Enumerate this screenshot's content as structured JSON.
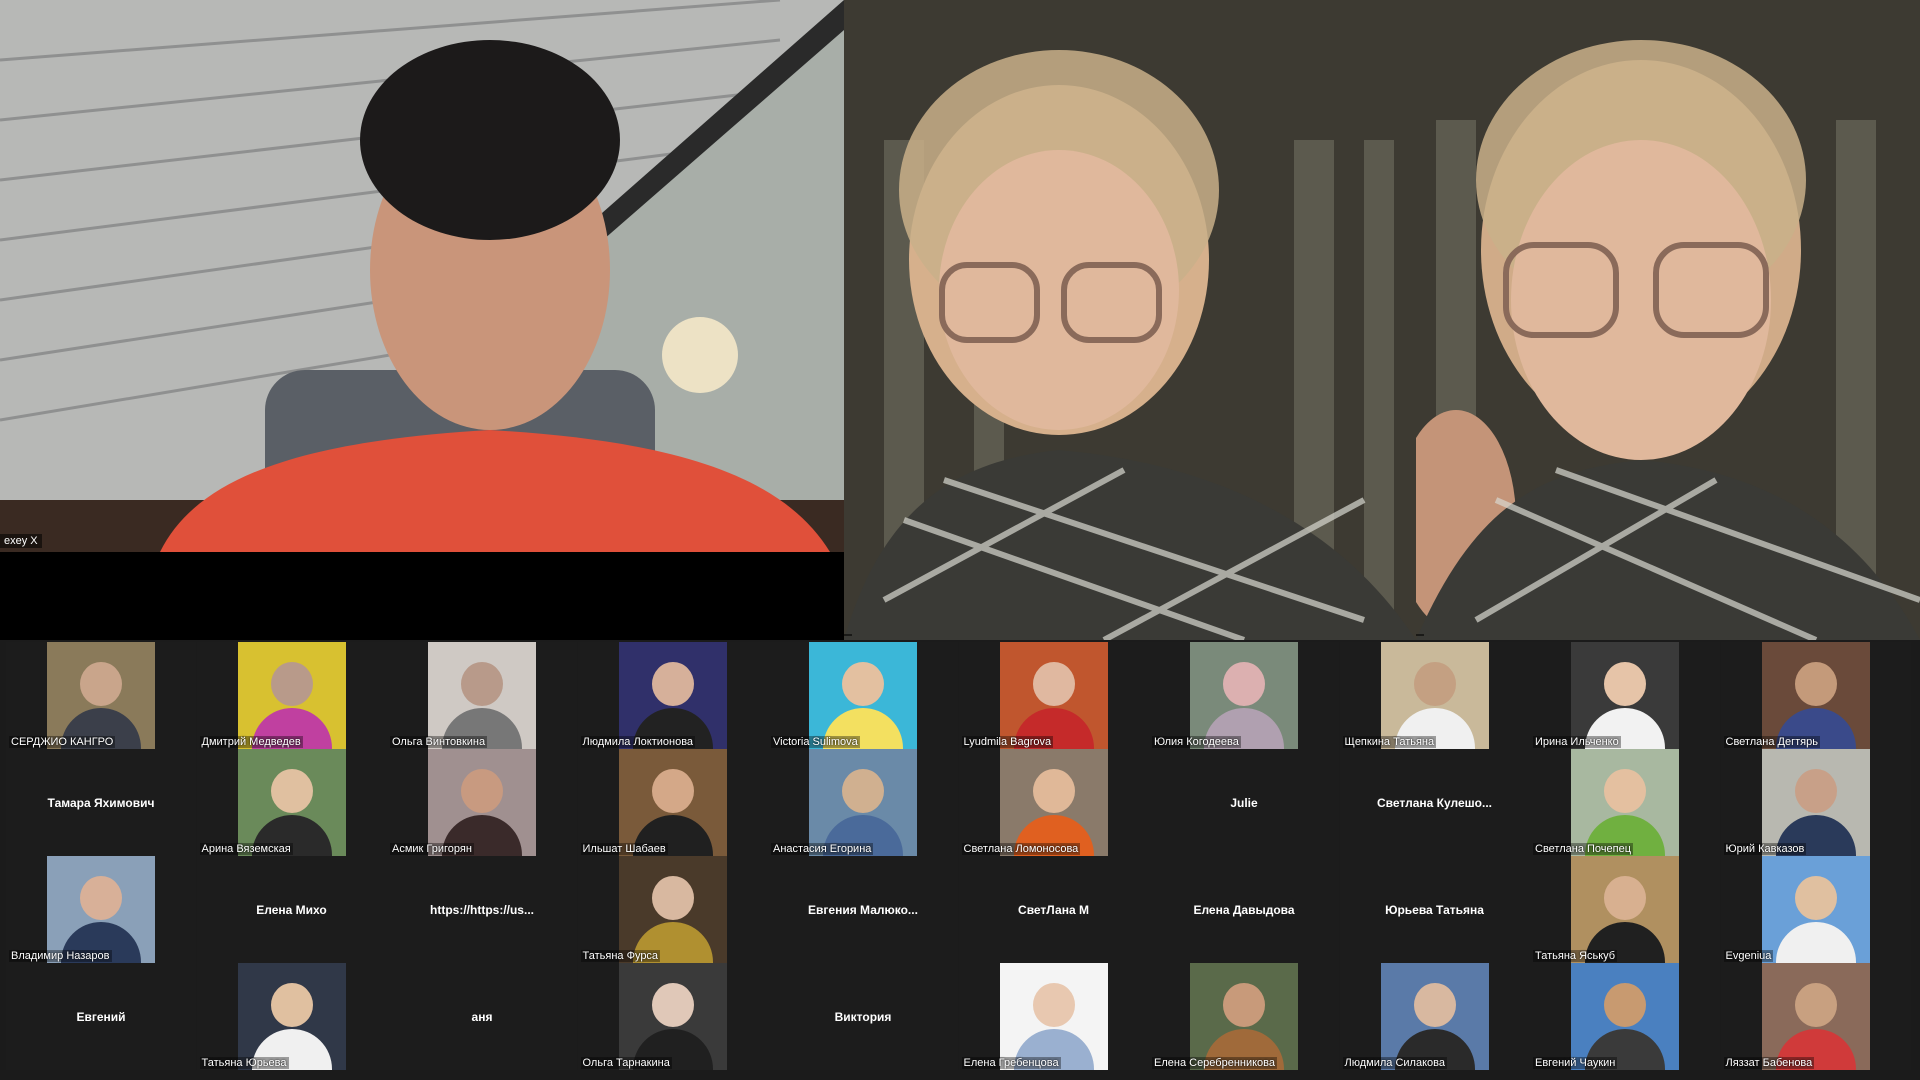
{
  "speakers": [
    {
      "name": "exey X"
    },
    {
      "name": ""
    },
    {
      "name": ""
    }
  ],
  "participants": [
    {
      "name": "СЕРДЖИО КАНГРО",
      "mode": "video",
      "bg": "#8a7a5a",
      "skin": "#c9a58b",
      "shirt": "#3b3f4a"
    },
    {
      "name": "Дмитрий Медведев",
      "mode": "video",
      "bg": "#d8c130",
      "skin": "#b89a8a",
      "shirt": "#c040a0"
    },
    {
      "name": "Ольга Винтовкина",
      "mode": "video",
      "bg": "#cfc9c4",
      "skin": "#b89a8a",
      "shirt": "#777"
    },
    {
      "name": "Людмила Локтионова",
      "mode": "video",
      "bg": "#30306a",
      "skin": "#d6b09a",
      "shirt": "#222"
    },
    {
      "name": "Victoria Sulimova",
      "mode": "video",
      "bg": "#3bb7d8",
      "skin": "#e3c0a0",
      "shirt": "#f3e060"
    },
    {
      "name": "Lyudmila Bagrova",
      "mode": "video",
      "bg": "#c0562e",
      "skin": "#e0b8a0",
      "shirt": "#c52a2a"
    },
    {
      "name": "Юлия Когодеева",
      "mode": "video",
      "bg": "#7a8a7a",
      "skin": "#dcb0b0",
      "shirt": "#b0a0b0"
    },
    {
      "name": "Щепкина Татьяна",
      "mode": "video",
      "bg": "#c9b99a",
      "skin": "#c4a082",
      "shirt": "#f0f0f0"
    },
    {
      "name": "Ирина Ильченко",
      "mode": "video",
      "bg": "#3a3a3a",
      "skin": "#e6c4a8",
      "shirt": "#f2f2f2"
    },
    {
      "name": "Светлана Дегтярь",
      "mode": "video",
      "bg": "#6a4a3a",
      "skin": "#c49a7a",
      "shirt": "#3a4a8a"
    },
    {
      "name": "Тамара Яхимович",
      "mode": "text"
    },
    {
      "name": "Арина Вяземская",
      "mode": "video",
      "bg": "#6a8a5a",
      "skin": "#e0c0a0",
      "shirt": "#2a2a2a"
    },
    {
      "name": "Асмик Григорян",
      "mode": "video",
      "bg": "#a09090",
      "skin": "#c89a80",
      "shirt": "#3a2a2a"
    },
    {
      "name": "Ильшат Шабаев",
      "mode": "video",
      "bg": "#7a5a3a",
      "skin": "#d4a888",
      "shirt": "#202020"
    },
    {
      "name": "Анастасия Егорина",
      "mode": "video",
      "bg": "#6a8aa8",
      "skin": "#d0b090",
      "shirt": "#4a6a9a"
    },
    {
      "name": "Светлана Ломоносова",
      "mode": "video",
      "bg": "#8a7a6a",
      "skin": "#e0b898",
      "shirt": "#e06020"
    },
    {
      "name": "Julie",
      "mode": "text"
    },
    {
      "name": "Светлана  Кулешо...",
      "mode": "text"
    },
    {
      "name": "Светлана Почепец",
      "mode": "video",
      "bg": "#a8b8a0",
      "skin": "#e4c0a0",
      "shirt": "#70b040"
    },
    {
      "name": "Юрий Кавказов",
      "mode": "video",
      "bg": "#b8b8b0",
      "skin": "#c8a088",
      "shirt": "#2a3a5a"
    },
    {
      "name": "Владимир Назаров",
      "mode": "video",
      "bg": "#8aa0b8",
      "skin": "#d8b098",
      "shirt": "#2a3a5a"
    },
    {
      "name": "Елена Михо",
      "mode": "text"
    },
    {
      "name": "https://https://us...",
      "mode": "text"
    },
    {
      "name": "Татьяна Фурса",
      "mode": "video",
      "bg": "#4a3a2a",
      "skin": "#d8b8a0",
      "shirt": "#b09030"
    },
    {
      "name": "Евгения  Малюко...",
      "mode": "text"
    },
    {
      "name": "СветЛана М",
      "mode": "text"
    },
    {
      "name": "Елена Давыдова",
      "mode": "text"
    },
    {
      "name": "Юрьева Татьяна",
      "mode": "text"
    },
    {
      "name": "Татьяна Яськуб",
      "mode": "video",
      "bg": "#b09060",
      "skin": "#d8b090",
      "shirt": "#202020"
    },
    {
      "name": "Evgeniua",
      "mode": "video",
      "bg": "#6aa0d8",
      "skin": "#e0c0a0",
      "shirt": "#f0f0f0"
    },
    {
      "name": "Евгений",
      "mode": "text"
    },
    {
      "name": "Татьяна Юрьева",
      "mode": "video",
      "bg": "#303848",
      "skin": "#e0c0a0",
      "shirt": "#f0f0f0"
    },
    {
      "name": "аня",
      "mode": "text"
    },
    {
      "name": "Ольга Тарнакина",
      "mode": "video",
      "bg": "#3a3a3a",
      "skin": "#e0c8b8",
      "shirt": "#202020"
    },
    {
      "name": "Виктория",
      "mode": "text"
    },
    {
      "name": "Елена Гребенцова",
      "mode": "video",
      "bg": "#f4f4f4",
      "skin": "#e8c8b0",
      "shirt": "#9ab0d0"
    },
    {
      "name": "Елена Серебренникова",
      "mode": "video",
      "bg": "#5a6a4a",
      "skin": "#c89a7a",
      "shirt": "#a06a3a"
    },
    {
      "name": "Людмила Силакова",
      "mode": "video",
      "bg": "#5a7aa8",
      "skin": "#d8b8a0",
      "shirt": "#2a2a2a"
    },
    {
      "name": "Евгений Чаукин",
      "mode": "video",
      "bg": "#4a80c0",
      "skin": "#c89a70",
      "shirt": "#3a3a3a"
    },
    {
      "name": "Ляззат Бабенова",
      "mode": "video",
      "bg": "#8a6a5a",
      "skin": "#c8a080",
      "shirt": "#d03a3a"
    }
  ]
}
